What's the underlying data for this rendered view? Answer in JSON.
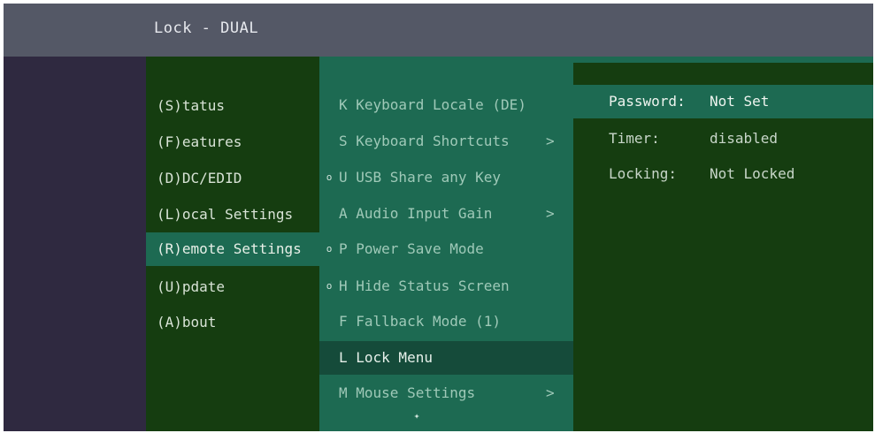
{
  "window": {
    "title": "Lock - DUAL"
  },
  "main_menu": {
    "items": [
      {
        "label": "(S)tatus",
        "selected": false
      },
      {
        "label": "(F)eatures",
        "selected": false
      },
      {
        "label": "(D)DC/EDID",
        "selected": false
      },
      {
        "label": "(L)ocal Settings",
        "selected": false
      },
      {
        "label": "(R)emote Settings",
        "selected": true
      },
      {
        "label": "(U)pdate",
        "selected": false
      },
      {
        "label": "(A)bout",
        "selected": false
      }
    ]
  },
  "submenu": {
    "items": [
      {
        "label": "K Keyboard Locale (DE)",
        "bullet": "",
        "arrow": "",
        "active": false
      },
      {
        "label": "S Keyboard Shortcuts",
        "bullet": "",
        "arrow": ">",
        "active": false
      },
      {
        "label": "U USB Share any Key",
        "bullet": "o",
        "arrow": "",
        "active": false
      },
      {
        "label": "A Audio Input Gain",
        "bullet": "",
        "arrow": ">",
        "active": false
      },
      {
        "label": "P Power Save Mode",
        "bullet": "o",
        "arrow": "",
        "active": false
      },
      {
        "label": "H Hide Status Screen",
        "bullet": "o",
        "arrow": "",
        "active": false
      },
      {
        "label": "F Fallback Mode (1)",
        "bullet": "",
        "arrow": "",
        "active": false
      },
      {
        "label": "L Lock Menu",
        "bullet": "",
        "arrow": "",
        "active": true
      },
      {
        "label": "M Mouse Settings",
        "bullet": "",
        "arrow": ">",
        "active": false
      }
    ],
    "more_indicator": "✦"
  },
  "lock_panel": {
    "rows": [
      {
        "key": "Password:",
        "value": "Not Set"
      },
      {
        "key": "Timer:",
        "value": "disabled"
      },
      {
        "key": "Locking:",
        "value": "Not Locked"
      }
    ]
  },
  "colors": {
    "titlebar": "#545866",
    "sidebar": "#2f2940",
    "panel_dark_green": "#153d10",
    "panel_teal": "#1d6a52",
    "active_item": "#154b3a"
  }
}
